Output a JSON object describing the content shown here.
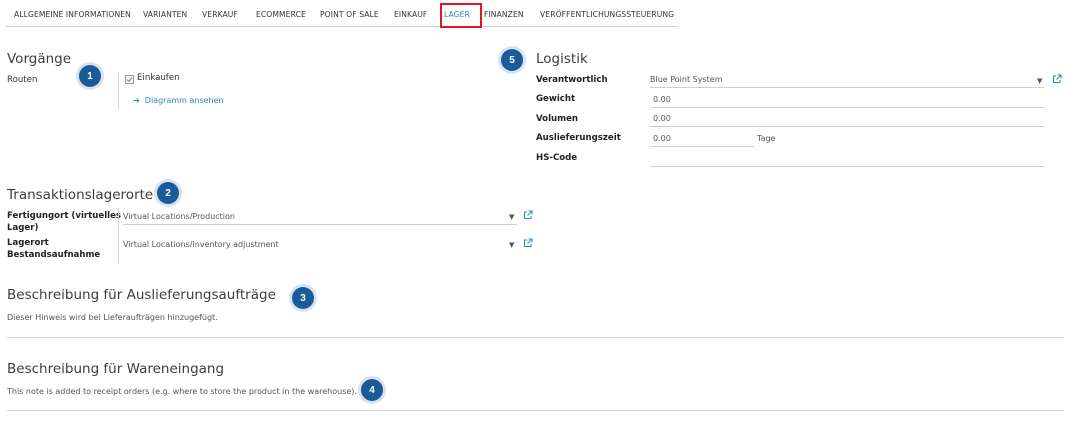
{
  "tabs": [
    {
      "label": "ALLGEMEINE INFORMATIONEN"
    },
    {
      "label": "VARIANTEN"
    },
    {
      "label": "VERKAUF"
    },
    {
      "label": "ECOMMERCE"
    },
    {
      "label": "POINT OF SALE"
    },
    {
      "label": "EINKAUF"
    },
    {
      "label": "LAGER",
      "active": true
    },
    {
      "label": "FINANZEN"
    },
    {
      "label": "VERÖFFENTLICHUNGSSTEUERUNG"
    }
  ],
  "colors": {
    "accent": "#2b8ab8",
    "highlight": "#e2161f",
    "badge": "#1b5b9a"
  },
  "vorgaenge": {
    "title": "Vorgänge",
    "routes_label": "Routen",
    "route_option": "Einkaufen",
    "route_checked": true,
    "diagram_link": "Diagramm ansehen"
  },
  "logistik": {
    "title": "Logistik",
    "responsible_label": "Verantwortlich",
    "responsible_value": "Blue Point System",
    "weight_label": "Gewicht",
    "weight_value": "0.00",
    "volume_label": "Volumen",
    "volume_value": "0.00",
    "lead_time_label": "Auslieferungszeit",
    "lead_time_value": "0.00",
    "lead_time_unit": "Tage",
    "hs_code_label": "HS-Code",
    "hs_code_value": ""
  },
  "locations": {
    "title": "Transaktionslagerorte",
    "production_label_1": "Fertigungort (virtuelles",
    "production_label_2": "Lager)",
    "production_value": "Virtual Locations/Production",
    "inventory_label_1": "Lagerort",
    "inventory_label_2": "Bestandsaufnahme",
    "inventory_value": "Virtual Locations/Inventory adjustment"
  },
  "delivery": {
    "title": "Beschreibung für Auslieferungsaufträge",
    "note": "Dieser Hinweis wird bei Lieferaufträgen hinzugefügt."
  },
  "receipt": {
    "title": "Beschreibung für Wareneingang",
    "note": "This note is added to receipt orders (e.g. where to store the product in the warehouse)."
  },
  "badges": [
    "1",
    "2",
    "3",
    "4",
    "5"
  ]
}
